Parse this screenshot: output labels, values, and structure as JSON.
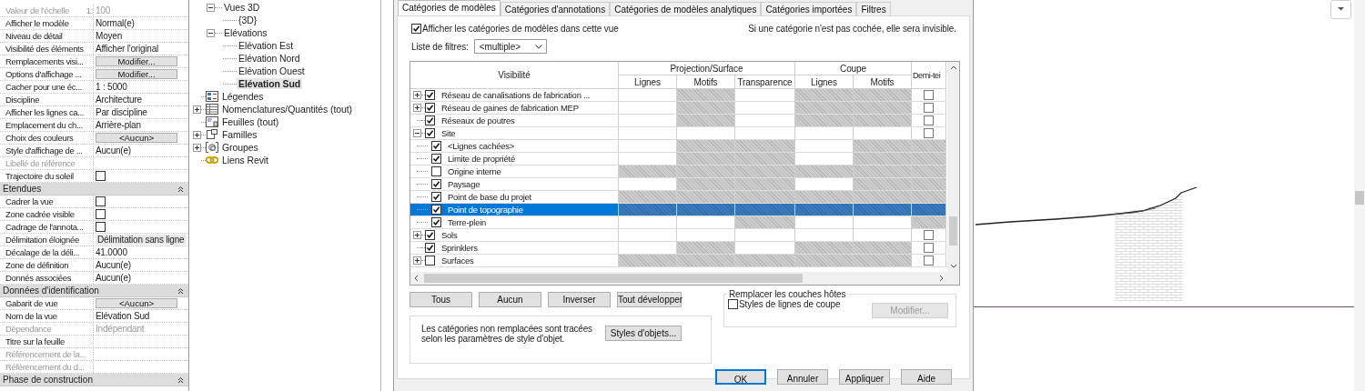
{
  "properties": {
    "rows": [
      {
        "kind": "text",
        "label": "Valeur de l'échelle",
        "label_suffix": "1:",
        "value": "100",
        "disabled": true
      },
      {
        "kind": "text",
        "label": "Afficher le modèle",
        "value": "Normal(e)",
        "disabled": false
      },
      {
        "kind": "text",
        "label": "Niveau de détail",
        "value": "Moyen",
        "disabled": false
      },
      {
        "kind": "text",
        "label": "Visibilité des éléments",
        "value": "Afficher l'original",
        "disabled": false
      },
      {
        "kind": "button",
        "label": "Remplacements visi...",
        "value": "Modifier...",
        "disabled": false
      },
      {
        "kind": "button",
        "label": "Options d'affichage ...",
        "value": "Modifier...",
        "disabled": false
      },
      {
        "kind": "text",
        "label": "Cacher pour une éc...",
        "value": "1 : 5000",
        "disabled": false
      },
      {
        "kind": "text",
        "label": "Discipline",
        "value": "Architecture",
        "disabled": false
      },
      {
        "kind": "text",
        "label": "Afficher les lignes ca...",
        "value": "Par discipline",
        "disabled": false
      },
      {
        "kind": "text",
        "label": "Emplacement du ch...",
        "value": "Arrière-plan",
        "disabled": false
      },
      {
        "kind": "button",
        "label": "Choix des couleurs",
        "value": "<Aucun>",
        "disabled": false
      },
      {
        "kind": "text",
        "label": "Style d'affichage de ...",
        "value": "Aucun(e)",
        "disabled": false
      },
      {
        "kind": "text",
        "label": "Libellé de référence",
        "disabled": true
      },
      {
        "kind": "checkbox",
        "label": "Trajectoire du soleil",
        "checked": false,
        "disabled": false
      },
      {
        "kind": "group",
        "label": "Etendues"
      },
      {
        "kind": "checkbox",
        "label": "Cadrer la vue",
        "checked": false,
        "disabled": false
      },
      {
        "kind": "checkbox",
        "label": "Zone cadrée visible",
        "checked": false,
        "disabled": false
      },
      {
        "kind": "checkbox",
        "label": "Cadrage de l'annota...",
        "checked": false,
        "disabled": false
      },
      {
        "kind": "field",
        "label": "Délimitation éloignée",
        "value": "Délimitation sans ligne",
        "disabled": false
      },
      {
        "kind": "text",
        "label": "Décalage de la déli...",
        "value": "41.0000",
        "disabled": false
      },
      {
        "kind": "text",
        "label": "Zone de définition",
        "value": "Aucun(e)",
        "disabled": false
      },
      {
        "kind": "text",
        "label": "Donnés associées",
        "value": "Aucun(e)",
        "disabled": false
      },
      {
        "kind": "group",
        "label": "Données d'identification"
      },
      {
        "kind": "button",
        "label": "Gabarit de vue",
        "value": "<Aucun>",
        "disabled": false
      },
      {
        "kind": "text",
        "label": "Nom de la vue",
        "value": "Elévation Sud",
        "disabled": false
      },
      {
        "kind": "text",
        "label": "Dépendance",
        "value": "Indépendant",
        "disabled": true
      },
      {
        "kind": "text",
        "label": "Titre sur la feuille",
        "disabled": false
      },
      {
        "kind": "text",
        "label": "Référencement de la...",
        "disabled": true
      },
      {
        "kind": "text",
        "label": "Référencement du d...",
        "disabled": true
      },
      {
        "kind": "group",
        "label": "Phase de construction"
      }
    ]
  },
  "browser": {
    "view_nodes": [
      {
        "label": "Vues 3D",
        "expanded": true,
        "selected": false,
        "children": [
          {
            "label": "{3D}",
            "selected": false
          }
        ]
      },
      {
        "label": "Elévations",
        "expanded": true,
        "selected": false,
        "children": [
          {
            "label": "Elévation Est",
            "selected": false
          },
          {
            "label": "Elévation Nord",
            "selected": false
          },
          {
            "label": "Elévation Ouest",
            "selected": false
          },
          {
            "label": "Elévation Sud",
            "selected": true
          }
        ]
      }
    ],
    "nodes": [
      {
        "kind": "legend",
        "label": "Légendes",
        "expandable": false,
        "selected": false
      },
      {
        "kind": "schedule",
        "label": "Nomenclatures/Quantités (tout)",
        "expandable": true,
        "selected": false
      },
      {
        "kind": "sheet",
        "label": "Feuilles (tout)",
        "expandable": false,
        "selected": false
      },
      {
        "kind": "family",
        "label": "Familles",
        "expandable": true,
        "selected": false
      },
      {
        "kind": "group",
        "label": "Groupes",
        "expandable": true,
        "selected": false
      },
      {
        "kind": "link",
        "label": "Liens Revit",
        "expandable": false,
        "selected": false
      }
    ]
  },
  "dialog": {
    "tabs": [
      {
        "label": "Catégories de modèles",
        "selected": true
      },
      {
        "label": "Catégories d'annotations",
        "selected": false
      },
      {
        "label": "Catégories de modèles analytiques",
        "selected": false
      },
      {
        "label": "Catégories importées",
        "selected": false
      },
      {
        "label": "Filtres",
        "selected": false
      }
    ],
    "show_categories": {
      "label": "Afficher les catégories de modèles dans cette vue",
      "checked": true
    },
    "hint": "Si une catégorie n'est pas cochée, elle sera invisible.",
    "filter_list": {
      "label": "Liste de filtres:",
      "value": "<multiple>"
    },
    "table": {
      "header": {
        "visibility": "Visibilité",
        "projection": "Projection/Surface",
        "cut": "Coupe",
        "halftone": "Demi-tei",
        "columns": [
          "Lignes",
          "Motifs",
          "Transparence",
          "Lignes",
          "Motifs"
        ]
      },
      "rows": [
        {
          "label": "Réseau de canalisations de fabrication ...",
          "checked": true,
          "expandable": true,
          "expanded": false,
          "selected": false,
          "hatched": [
            false,
            true,
            false,
            true,
            true
          ],
          "halftone": {
            "kind": "checkbox",
            "checked": false
          }
        },
        {
          "label": "Réseau de gaines de fabrication MEP",
          "checked": true,
          "expandable": true,
          "expanded": false,
          "selected": false,
          "hatched": [
            false,
            true,
            false,
            true,
            true
          ],
          "halftone": {
            "kind": "checkbox",
            "checked": false
          }
        },
        {
          "label": "Réseaux de poutres",
          "checked": true,
          "expandable": false,
          "expanded": false,
          "selected": false,
          "hatched": [
            false,
            true,
            false,
            true,
            true
          ],
          "halftone": {
            "kind": "checkbox",
            "checked": false
          }
        },
        {
          "label": "Site",
          "checked": true,
          "expandable": true,
          "expanded": true,
          "selected": false,
          "hatched": [
            false,
            false,
            false,
            false,
            false
          ],
          "halftone": {
            "kind": "checkbox",
            "checked": false
          },
          "children": [
            {
              "label": "<Lignes cachées>",
              "checked": true,
              "selected": false,
              "hatched": [
                false,
                true,
                true,
                false,
                true
              ],
              "halftone": {
                "kind": "hatched"
              }
            },
            {
              "label": "Limite de propriété",
              "checked": true,
              "selected": false,
              "hatched": [
                false,
                true,
                true,
                false,
                true
              ],
              "halftone": {
                "kind": "hatched"
              }
            },
            {
              "label": "Origine interne",
              "checked": false,
              "selected": false,
              "hatched": [
                true,
                true,
                true,
                true,
                true
              ],
              "halftone": {
                "kind": "hatched"
              }
            },
            {
              "label": "Paysage",
              "checked": true,
              "selected": false,
              "hatched": [
                false,
                true,
                true,
                false,
                true
              ],
              "halftone": {
                "kind": "hatched"
              }
            },
            {
              "label": "Point de base du projet",
              "checked": true,
              "selected": false,
              "hatched": [
                true,
                true,
                true,
                true,
                true
              ],
              "halftone": {
                "kind": "hatched"
              }
            },
            {
              "label": "Point de topographie",
              "checked": true,
              "selected": true,
              "hatched": [
                true,
                true,
                true,
                true,
                true
              ],
              "halftone": {
                "kind": "hatched"
              }
            },
            {
              "label": "Terre-plein",
              "checked": true,
              "selected": false,
              "hatched": [
                false,
                false,
                true,
                false,
                false
              ],
              "halftone": {
                "kind": "hatched"
              }
            }
          ]
        },
        {
          "label": "Sols",
          "checked": true,
          "expandable": true,
          "expanded": false,
          "selected": false,
          "hatched": [
            false,
            false,
            false,
            false,
            false
          ],
          "halftone": {
            "kind": "checkbox",
            "checked": false
          }
        },
        {
          "label": "Sprinklers",
          "checked": true,
          "expandable": false,
          "expanded": false,
          "selected": false,
          "hatched": [
            false,
            true,
            false,
            true,
            true
          ],
          "halftone": {
            "kind": "checkbox",
            "checked": false
          }
        },
        {
          "label": "Surfaces",
          "checked": false,
          "expandable": true,
          "expanded": false,
          "selected": false,
          "hatched": [
            true,
            true,
            true,
            true,
            true
          ],
          "halftone": {
            "kind": "checkbox",
            "checked": false
          }
        }
      ]
    },
    "actions": [
      "Tous",
      "Aucun",
      "Inverser",
      "Tout développer"
    ],
    "note": {
      "text": "Les catégories non remplacées sont tracées selon les paramètres de style d'objet.",
      "button": "Styles d'objets..."
    },
    "host_layers": {
      "title": "Remplacer les couches hôtes",
      "checkbox": {
        "label": "Styles de lignes de coupe",
        "checked": false
      },
      "button": {
        "label": "Modifier...",
        "disabled": true
      }
    },
    "footer_buttons": [
      {
        "label": "OK",
        "default": true
      },
      {
        "label": "Annuler",
        "default": false
      },
      {
        "label": "Appliquer",
        "default": false
      },
      {
        "label": "Aide",
        "default": false
      }
    ]
  }
}
